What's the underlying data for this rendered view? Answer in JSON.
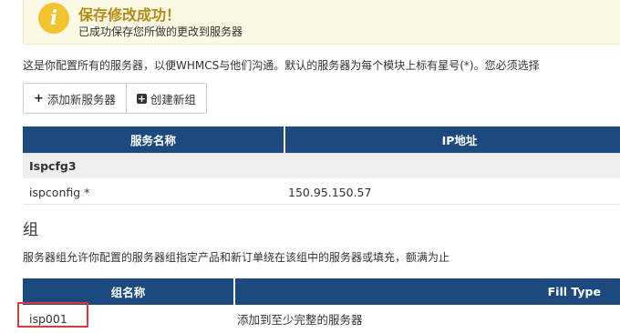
{
  "alert": {
    "icon": "info-icon",
    "title": "保存修改成功！",
    "message": "已成功保存您所做的更改到服务器"
  },
  "intro": "这是你配置所有的服务器，以便WHMCS与他们沟通。默认的服务器为每个模块上标有星号(*)。您必须选择",
  "toolbar": {
    "add_server_label": "添加新服务器",
    "create_group_label": "创建新组"
  },
  "servers_table": {
    "columns": [
      "服务名称",
      "IP地址"
    ],
    "group_name": "Ispcfg3",
    "rows": [
      {
        "name": "ispconfig *",
        "ip": "150.95.150.57"
      }
    ]
  },
  "groups_section": {
    "heading": "组",
    "description": "服务器组允许你配置的服务器组指定产品和新订单绕在该组中的服务器或填充，额满为止"
  },
  "groups_table": {
    "columns": [
      "组名称",
      "Fill Type"
    ],
    "rows": [
      {
        "name": "isp001",
        "fill_type": "添加到至少完整的服务器"
      }
    ]
  },
  "colors": {
    "table_header": "#1c4a7e",
    "alert_bg": "#fbf8e3",
    "alert_title": "#b58a16",
    "highlight": "#d93a3a"
  }
}
